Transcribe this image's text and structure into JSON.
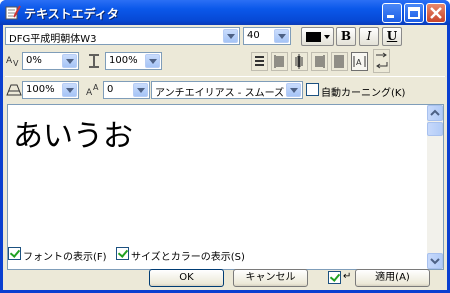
{
  "window": {
    "title": "テキストエディタ"
  },
  "toolbar": {
    "font_name": "DFG平成明朝体W3",
    "font_size": "40",
    "text_color": "#000000",
    "bold_label": "B",
    "italic_label": "I",
    "underline_label": "U",
    "tracking": "0%",
    "line_spacing": "100%",
    "scale": "100%",
    "baseline_shift": "0",
    "antialias": "アンチエイリアス - スムーズ",
    "auto_kerning_label": "自動カーニング(K)"
  },
  "editor": {
    "text": "あいうお"
  },
  "footer": {
    "show_font_label": "フォントの表示(F)",
    "show_size_color_label": "サイズとカラーの表示(S)",
    "ok_label": "OK",
    "cancel_label": "キャンセル",
    "apply_label": "適用(A)",
    "return_symbol": "↵"
  },
  "icons": [
    "text-editor-icon",
    "minimize-icon",
    "maximize-icon",
    "close-icon",
    "tracking-icon",
    "line-spacing-icon",
    "scale-icon",
    "baseline-shift-icon"
  ]
}
